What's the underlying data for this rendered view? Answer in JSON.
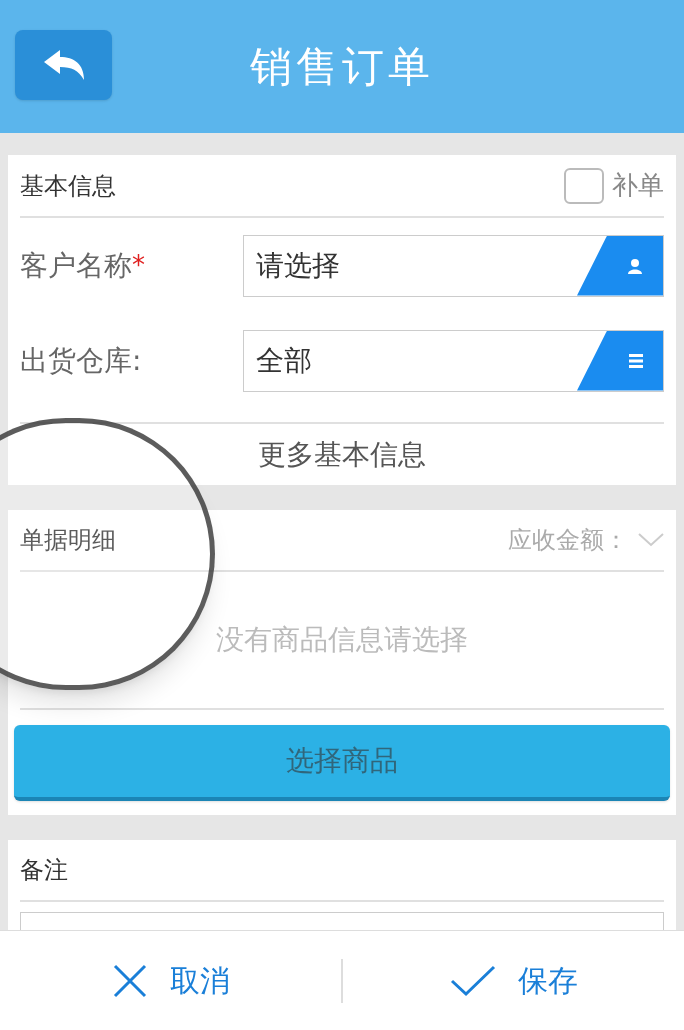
{
  "header": {
    "title": "销售订单"
  },
  "basic_info": {
    "title": "基本信息",
    "supplement": {
      "label": "补单",
      "checked": false
    },
    "fields": [
      {
        "label": "客户名称",
        "required_mark": "*",
        "value": "请选择",
        "kind": "person"
      },
      {
        "label": "出货仓库:",
        "value": "全部",
        "kind": "list"
      }
    ],
    "more_link": "更多基本信息"
  },
  "details": {
    "title": "单据明细",
    "amount_label": "应收金额：",
    "empty_text": "没有商品信息请选择",
    "select_button": "选择商品"
  },
  "remarks": {
    "title": "备注"
  },
  "footer": {
    "buttons": [
      {
        "label": "取消",
        "kind": "cancel"
      },
      {
        "label": "保存",
        "kind": "save"
      }
    ]
  }
}
